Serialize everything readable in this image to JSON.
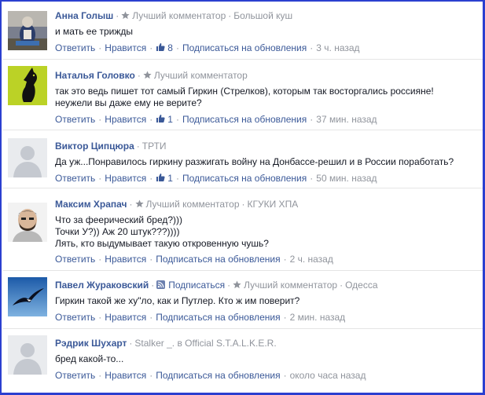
{
  "colors": {
    "frame": "#2b3fd0",
    "link": "#3b5998",
    "meta": "#90949c",
    "text": "#141823",
    "divider": "#e5e5e5"
  },
  "comments": [
    {
      "author": "Анна Голыш",
      "top_commentator": "Лучший комментатор",
      "affiliation": "Большой куш",
      "lines": [
        "и мать ее трижды"
      ],
      "reply": "Ответить",
      "like": "Нравится",
      "likes": "8",
      "subscribe": "Подписаться на обновления",
      "time": "3 ч. назад",
      "avatar_icon": "cat-photo-avatar"
    },
    {
      "author": "Наталья Головко",
      "top_commentator": "Лучший комментатор",
      "lines": [
        "так это ведь пишет тот самый Гиркин (Стрелков), которым так восторгались россияне!",
        "неужели вы даже ему не верите?"
      ],
      "reply": "Ответить",
      "like": "Нравится",
      "likes": "1",
      "subscribe": "Подписаться на обновления",
      "time": "37 мин. назад",
      "avatar_icon": "black-cat-avatar"
    },
    {
      "author": "Виктор Ципцюра",
      "affiliation": "ТРТИ",
      "lines": [
        "Да уж...Понравилось гиркину разжигать войну на Донбассе-решил и в России поработать?"
      ],
      "reply": "Ответить",
      "like": "Нравится",
      "likes": "1",
      "subscribe": "Подписаться на обновления",
      "time": "50 мин. назад",
      "avatar_icon": "default-avatar"
    },
    {
      "author": "Максим Храпач",
      "top_commentator": "Лучший комментатор",
      "affiliation": "КГУКИ ХПА",
      "lines": [
        "Что за феерический бред?)))",
        "Точки У?)) Аж 20 штук???))))",
        "Лять, кто выдумывает такую откровенную чушь?"
      ],
      "reply": "Ответить",
      "like": "Нравится",
      "subscribe": "Подписаться на обновления",
      "time": "2 ч. назад",
      "avatar_icon": "man-photo-avatar"
    },
    {
      "author": "Павел Жураковский",
      "subscribe_label": "Подписаться",
      "top_commentator": "Лучший комментатор",
      "affiliation": "Одесса",
      "lines": [
        "Гиркин такой же ху\"ло, как и Путлер. Кто ж им поверит?"
      ],
      "reply": "Ответить",
      "like": "Нравится",
      "subscribe": "Подписаться на обновления",
      "time": "2 мин. назад",
      "avatar_icon": "bird-sky-avatar"
    },
    {
      "author": "Рэдрик Шухарт",
      "affiliation_prefix": "Stalker _. в",
      "affiliation": "Official S.T.A.L.K.E.R.",
      "lines": [
        "бред какой-то..."
      ],
      "reply": "Ответить",
      "like": "Нравится",
      "subscribe": "Подписаться на обновления",
      "time": "около часа назад",
      "avatar_icon": "default-avatar"
    }
  ]
}
